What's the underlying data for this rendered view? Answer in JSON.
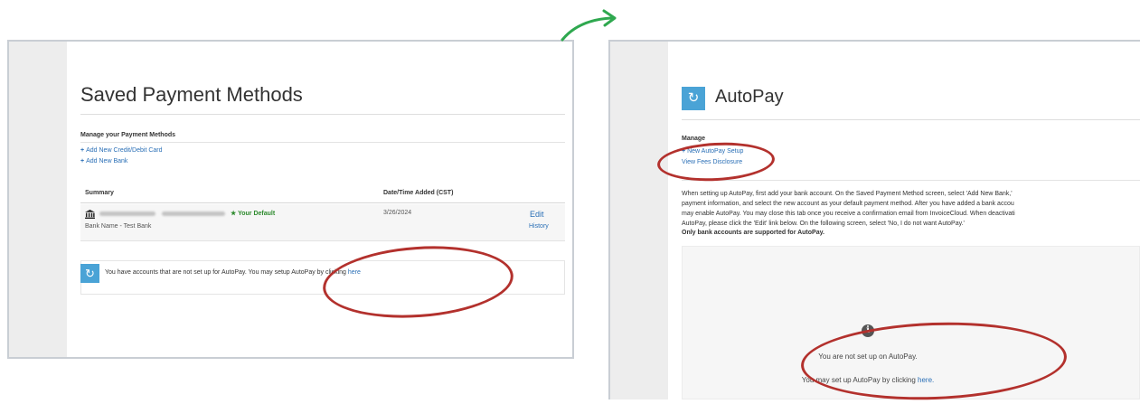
{
  "left": {
    "title": "Saved Payment Methods",
    "manage_heading": "Manage your Payment Methods",
    "links": [
      {
        "plus": "+",
        "label": "Add New Credit/Debit Card"
      },
      {
        "plus": "+",
        "label": "Add New Bank"
      }
    ],
    "table": {
      "headers": [
        "Summary",
        "Date/Time Added (CST)"
      ],
      "rows": [
        {
          "default_badge": "★ Your Default",
          "bank_name": "Bank Name - Test Bank",
          "date_added": "3/26/2024",
          "edit": "Edit",
          "history": "History"
        }
      ]
    },
    "autopay_notice": {
      "text": "You have accounts that are not set up for AutoPay. You may setup AutoPay by clicking ",
      "link": "here"
    },
    "icons": {
      "refresh": "refresh-icon",
      "bank": "bank-icon"
    }
  },
  "right": {
    "title": "AutoPay",
    "manage_heading": "Manage",
    "links": [
      {
        "plus": "+",
        "label": "New AutoPay Setup"
      },
      {
        "plus": "",
        "label": "View Fees Disclosure"
      }
    ],
    "paragraph_lines": [
      "When setting up AutoPay, first add your bank account. On the Saved Payment Method screen, select 'Add New Bank,'",
      "payment information, and select the new account as your default payment method. After you have added a bank accou",
      "may enable AutoPay. You may close this tab once you receive a confirmation email from InvoiceCloud. When deactivati",
      "AutoPay, please click the 'Edit' link below. On the following screen, select 'No, I do not want AutoPay.'"
    ],
    "only_bank": "Only bank accounts are supported for AutoPay.",
    "status_line1": "You are not set up on AutoPay.",
    "status_line2_prefix": "You may set up AutoPay by clicking ",
    "status_line2_link": "here.",
    "icons": {
      "refresh": "refresh-icon",
      "info": "info-icon"
    }
  },
  "colors": {
    "accent_blue": "#4aa3d6",
    "link_blue": "#2a6fb6",
    "annotation_red": "#b3312d",
    "arrow_green": "#2fa84f",
    "default_green": "#2e8b2e"
  }
}
